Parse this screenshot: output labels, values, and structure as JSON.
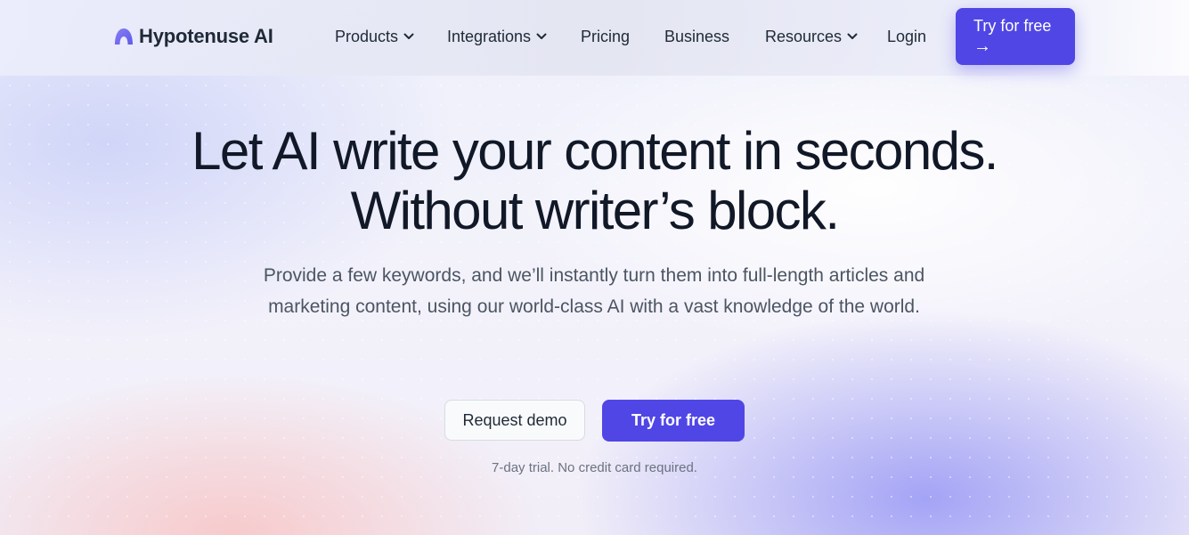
{
  "brand": {
    "name": "Hypotenuse AI",
    "accent_color": "#5046e5",
    "logo_icon": "hypotenuse-logo-icon"
  },
  "nav": {
    "items": [
      {
        "label": "Products",
        "has_dropdown": true
      },
      {
        "label": "Integrations",
        "has_dropdown": true
      },
      {
        "label": "Pricing",
        "has_dropdown": false
      },
      {
        "label": "Business",
        "has_dropdown": false
      },
      {
        "label": "Resources",
        "has_dropdown": true
      },
      {
        "label": "Login",
        "has_dropdown": false
      }
    ],
    "dropdown_icon": "chevron-down-icon",
    "cta_label": "Try for free",
    "cta_arrow": "→"
  },
  "hero": {
    "headline_line1": "Let AI write your content in seconds.",
    "headline_line2": "Without writer’s block.",
    "subheadline": "Provide a few keywords, and we’ll instantly turn them into full-length articles and marketing content, using our world-class AI with a vast knowledge of the world.",
    "secondary_button": "Request demo",
    "primary_button": "Try for free",
    "trial_note": "7-day trial. No credit card required."
  }
}
